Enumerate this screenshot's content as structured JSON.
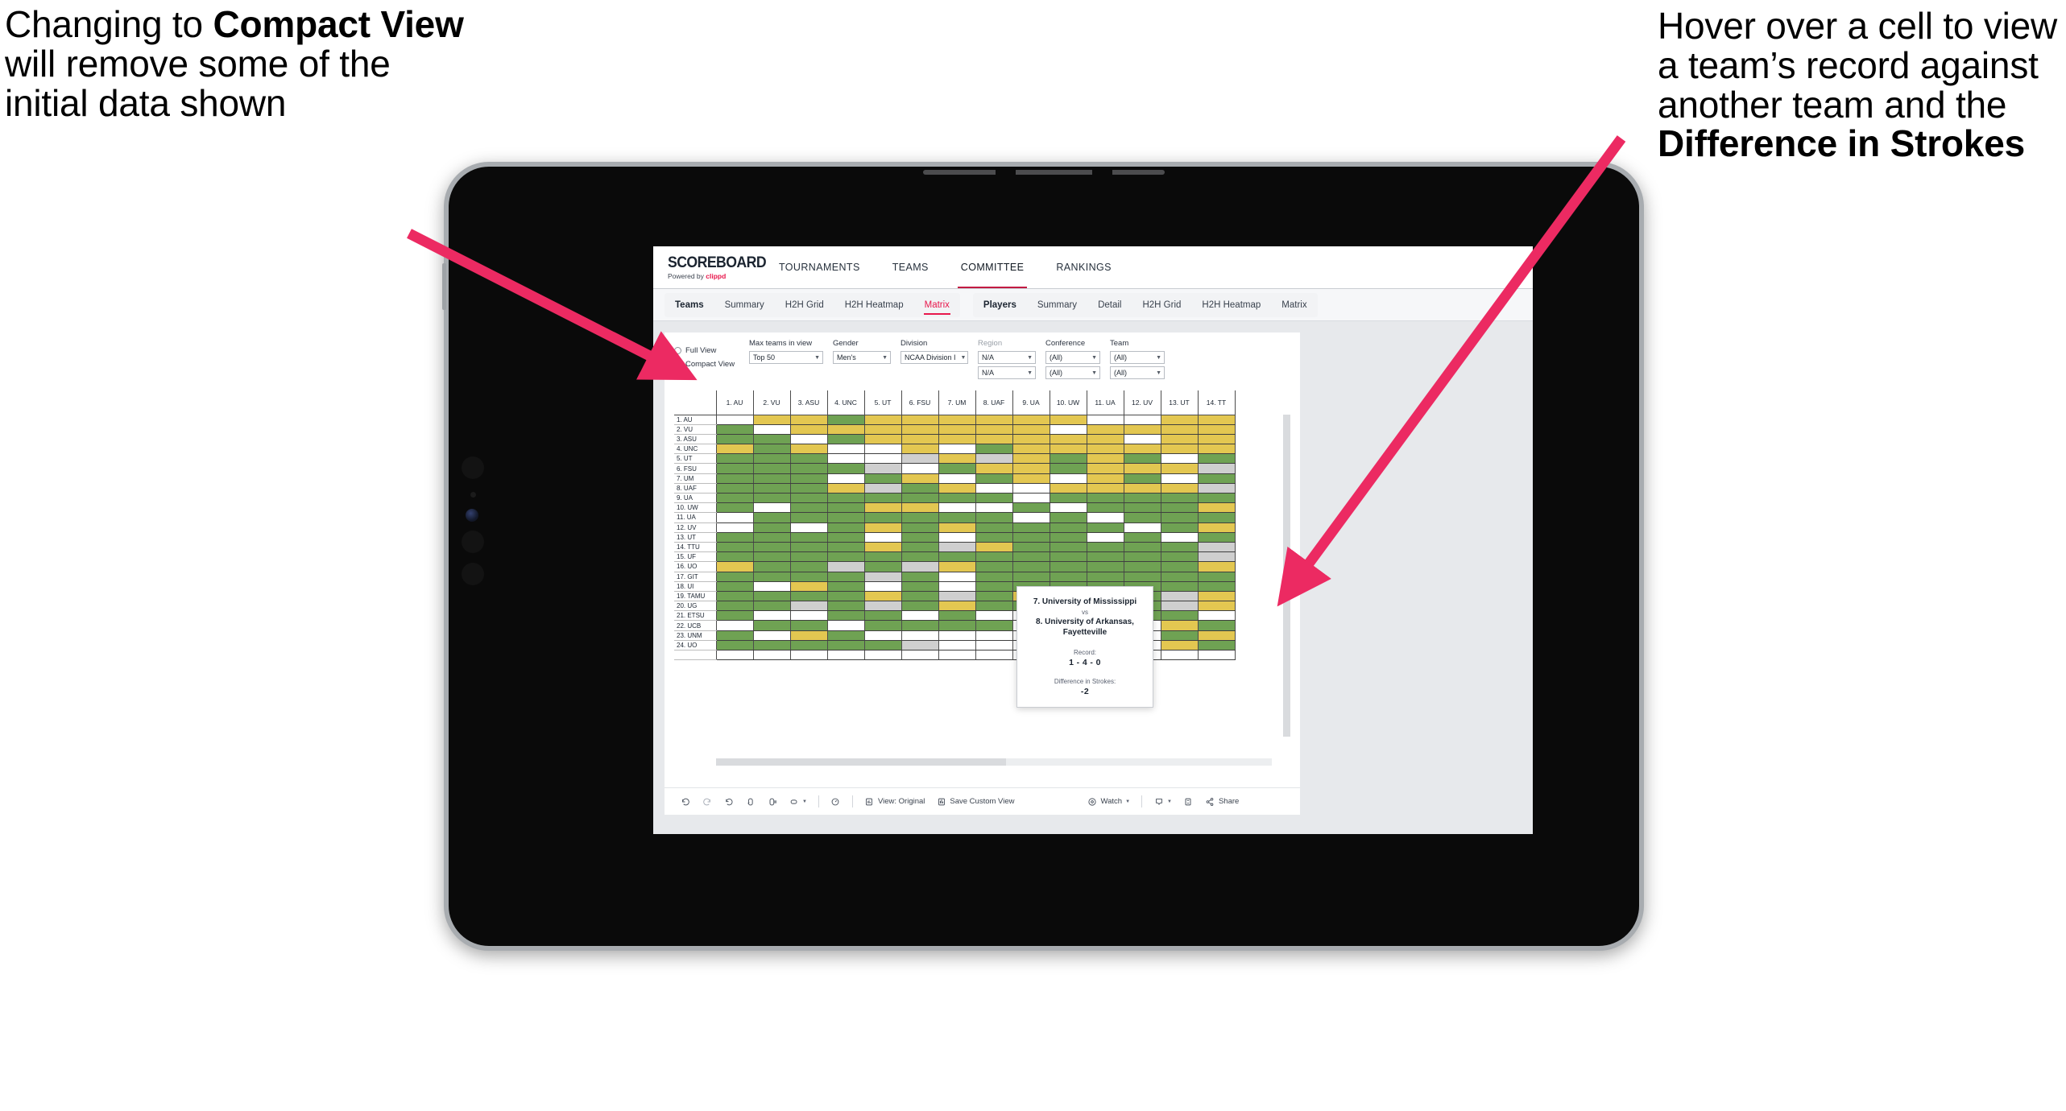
{
  "annotations": {
    "left": {
      "pre": "Changing to ",
      "bold": "Compact View",
      "post": " will remove some of the initial data shown"
    },
    "right": {
      "pre": "Hover over a cell to view a team’s record against another team and the ",
      "bold": "Difference in Strokes",
      "post": ""
    },
    "arrow_color": "#ec2a62"
  },
  "app": {
    "brand": {
      "logo": "SCOREBOARD",
      "powered_prefix": "Powered by ",
      "powered_name": "clippd"
    },
    "nav": [
      {
        "label": "TOURNAMENTS",
        "active": false
      },
      {
        "label": "TEAMS",
        "active": false
      },
      {
        "label": "COMMITTEE",
        "active": true
      },
      {
        "label": "RANKINGS",
        "active": false
      }
    ],
    "subtabs": {
      "group1": [
        {
          "label": "Teams",
          "head": true,
          "selected": false
        },
        {
          "label": "Summary",
          "head": false,
          "selected": false
        },
        {
          "label": "H2H Grid",
          "head": false,
          "selected": false
        },
        {
          "label": "H2H Heatmap",
          "head": false,
          "selected": false
        },
        {
          "label": "Matrix",
          "head": false,
          "selected": true
        }
      ],
      "group2": [
        {
          "label": "Players",
          "head": true,
          "selected": false
        },
        {
          "label": "Summary",
          "head": false,
          "selected": false
        },
        {
          "label": "Detail",
          "head": false,
          "selected": false
        },
        {
          "label": "H2H Grid",
          "head": false,
          "selected": false
        },
        {
          "label": "H2H Heatmap",
          "head": false,
          "selected": false
        },
        {
          "label": "Matrix",
          "head": false,
          "selected": false
        }
      ]
    },
    "filters": {
      "view_mode": {
        "options": [
          "Full View",
          "Compact View"
        ],
        "selected": "Compact View"
      },
      "max_teams": {
        "label": "Max teams in view",
        "value": "Top 50"
      },
      "gender": {
        "label": "Gender",
        "value": "Men's"
      },
      "division": {
        "label": "Division",
        "value": "NCAA Division I"
      },
      "region": {
        "label": "Region",
        "value1": "N/A",
        "value2": "N/A"
      },
      "conference": {
        "label": "Conference",
        "value1": "(All)",
        "value2": "(All)"
      },
      "team": {
        "label": "Team",
        "value1": "(All)",
        "value2": "(All)"
      }
    },
    "tooltip": {
      "team_a": "7. University of Mississippi",
      "vs": "vs",
      "team_b": "8. University of Arkansas, Fayetteville",
      "record_label": "Record:",
      "record_value": "1 - 4 - 0",
      "diff_label": "Difference in Strokes:",
      "diff_value": "-2"
    },
    "toolbar": {
      "undo": "undo-icon",
      "redo": "redo-icon",
      "revert": "revert-icon",
      "refresh": "refresh-icon",
      "pause": "pause-icon",
      "highlight": "highlight-icon",
      "alerts": "alerts-icon",
      "view_original": "View: Original",
      "save_custom_view": "Save Custom View",
      "watch": "Watch",
      "download": "download-icon",
      "fullscreen": "fullscreen-icon",
      "share": "Share"
    }
  },
  "chart_data": {
    "type": "heatmap",
    "title": "Team Head-to-Head Matrix",
    "legend": {
      "green": "#6fa253",
      "yellow": "#e3c751",
      "white": "#ffffff",
      "grey": "#cfcfcf"
    },
    "categories_x": [
      "1. AU",
      "2. VU",
      "3. ASU",
      "4. UNC",
      "5. UT",
      "6. FSU",
      "7. UM",
      "8. UAF",
      "9. UA",
      "10. UW",
      "11. UA",
      "12. UV",
      "13. UT",
      "14. TT"
    ],
    "categories_y": [
      "1. AU",
      "2. VU",
      "3. ASU",
      "4. UNC",
      "5. UT",
      "6. FSU",
      "7. UM",
      "8. UAF",
      "9. UA",
      "10. UW",
      "11. UA",
      "12. UV",
      "13. UT",
      "14. TTU",
      "15. UF",
      "16. UO",
      "17. GIT",
      "18. UI",
      "19. TAMU",
      "20. UG",
      "21. ETSU",
      "22. UCB",
      "23. UNM",
      "24. UO"
    ],
    "cells": [
      [
        "w",
        "y",
        "y",
        "g",
        "y",
        "y",
        "y",
        "y",
        "y",
        "y",
        "w",
        "w",
        "y",
        "y"
      ],
      [
        "g",
        "w",
        "y",
        "y",
        "y",
        "y",
        "y",
        "y",
        "y",
        "w",
        "y",
        "y",
        "y",
        "y"
      ],
      [
        "g",
        "g",
        "w",
        "g",
        "y",
        "y",
        "y",
        "y",
        "y",
        "y",
        "y",
        "w",
        "y",
        "y"
      ],
      [
        "y",
        "g",
        "y",
        "w",
        "w",
        "y",
        "w",
        "g",
        "y",
        "y",
        "y",
        "y",
        "y",
        "y"
      ],
      [
        "g",
        "g",
        "g",
        "w",
        "w",
        "a",
        "y",
        "a",
        "y",
        "g",
        "y",
        "g",
        "w",
        "g"
      ],
      [
        "g",
        "g",
        "g",
        "g",
        "a",
        "w",
        "g",
        "y",
        "y",
        "g",
        "y",
        "y",
        "y",
        "a"
      ],
      [
        "g",
        "g",
        "g",
        "w",
        "g",
        "y",
        "w",
        "g",
        "y",
        "w",
        "y",
        "g",
        "w",
        "g"
      ],
      [
        "g",
        "g",
        "g",
        "y",
        "a",
        "g",
        "y",
        "w",
        "w",
        "y",
        "y",
        "y",
        "y",
        "a"
      ],
      [
        "g",
        "g",
        "g",
        "g",
        "g",
        "g",
        "g",
        "g",
        "w",
        "g",
        "g",
        "g",
        "g",
        "g"
      ],
      [
        "g",
        "w",
        "g",
        "g",
        "y",
        "y",
        "w",
        "w",
        "g",
        "w",
        "g",
        "g",
        "g",
        "y"
      ],
      [
        "w",
        "g",
        "g",
        "g",
        "g",
        "g",
        "g",
        "g",
        "w",
        "g",
        "w",
        "g",
        "g",
        "g"
      ],
      [
        "w",
        "g",
        "w",
        "g",
        "y",
        "g",
        "y",
        "g",
        "g",
        "g",
        "g",
        "w",
        "g",
        "y"
      ],
      [
        "g",
        "g",
        "g",
        "g",
        "w",
        "g",
        "w",
        "g",
        "g",
        "g",
        "w",
        "g",
        "w",
        "g"
      ],
      [
        "g",
        "g",
        "g",
        "g",
        "y",
        "g",
        "a",
        "y",
        "g",
        "g",
        "g",
        "g",
        "g",
        "a"
      ],
      [
        "g",
        "g",
        "g",
        "g",
        "g",
        "g",
        "g",
        "g",
        "g",
        "g",
        "g",
        "g",
        "g",
        "a"
      ],
      [
        "y",
        "g",
        "g",
        "a",
        "g",
        "a",
        "y",
        "g",
        "g",
        "g",
        "g",
        "g",
        "g",
        "y"
      ],
      [
        "g",
        "g",
        "g",
        "g",
        "a",
        "g",
        "w",
        "g",
        "g",
        "g",
        "g",
        "g",
        "g",
        "g"
      ],
      [
        "g",
        "w",
        "y",
        "g",
        "w",
        "g",
        "w",
        "g",
        "g",
        "g",
        "g",
        "g",
        "g",
        "g"
      ],
      [
        "g",
        "g",
        "g",
        "g",
        "y",
        "g",
        "a",
        "g",
        "y",
        "g",
        "g",
        "g",
        "a",
        "y"
      ],
      [
        "g",
        "g",
        "a",
        "g",
        "a",
        "g",
        "y",
        "g",
        "g",
        "w",
        "w",
        "g",
        "a",
        "y"
      ],
      [
        "g",
        "w",
        "w",
        "g",
        "g",
        "w",
        "g",
        "w",
        "w",
        "y",
        "w",
        "g",
        "g",
        "w"
      ],
      [
        "w",
        "g",
        "g",
        "w",
        "g",
        "g",
        "g",
        "g",
        "w",
        "g",
        "y",
        "w",
        "y",
        "g"
      ],
      [
        "g",
        "w",
        "y",
        "g",
        "w",
        "w",
        "w",
        "w",
        "w",
        "y",
        "g",
        "w",
        "g",
        "y"
      ],
      [
        "g",
        "g",
        "g",
        "g",
        "g",
        "a",
        "w",
        "w",
        "w",
        "g",
        "y",
        "w",
        "y",
        "g"
      ]
    ]
  }
}
